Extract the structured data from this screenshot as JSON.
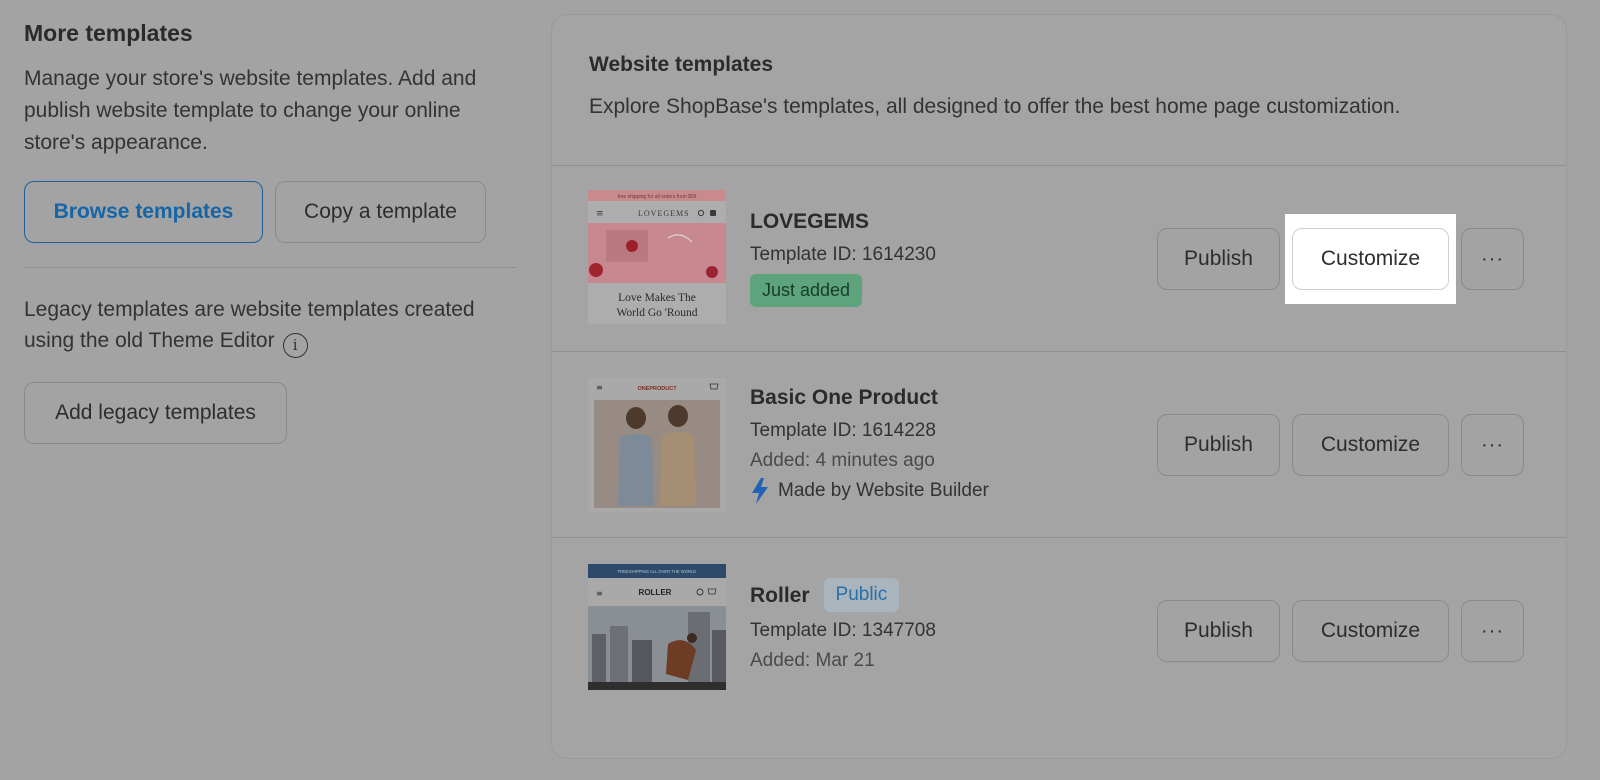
{
  "left": {
    "title": "More templates",
    "description": "Manage your store's website templates. Add and publish website template to change your online store's appearance.",
    "browse_label": "Browse templates",
    "copy_label": "Copy a template",
    "legacy_text": "Legacy templates are website templates created using the old Theme Editor",
    "add_legacy_label": "Add legacy templates"
  },
  "card": {
    "title": "Website templates",
    "subtitle": "Explore ShopBase's templates, all designed to offer the best home page customization."
  },
  "templates": [
    {
      "name": "LOVEGEMS",
      "template_id": "Template ID: 1614230",
      "badge": "Just added",
      "thumb": {
        "banner": "free shipping for all orders from $99",
        "brand": "LOVEGEMS",
        "tagline1": "Love Makes The",
        "tagline2": "World Go 'Round"
      }
    },
    {
      "name": "Basic One Product",
      "template_id": "Template ID: 1614228",
      "added": "Added: 4 minutes ago",
      "made_by": "Made by Website Builder",
      "thumb": {
        "brand": "ONEPRODUCT"
      }
    },
    {
      "name": "Roller",
      "badge": "Public",
      "template_id": "Template ID: 1347708",
      "added": "Added: Mar 21",
      "thumb": {
        "banner": "FREESHIPPING ALL OVER THE WORLD",
        "brand": "ROLLER"
      }
    }
  ],
  "actions": {
    "publish_label": "Publish",
    "customize_label": "Customize",
    "more_label": "···"
  },
  "colors": {
    "overlay_bg": "#a3a3a3",
    "primary_text": "#1565a8",
    "just_added_bg": "#5da47c",
    "public_text": "#2b6fa7",
    "bolt": "#1f63b5"
  }
}
